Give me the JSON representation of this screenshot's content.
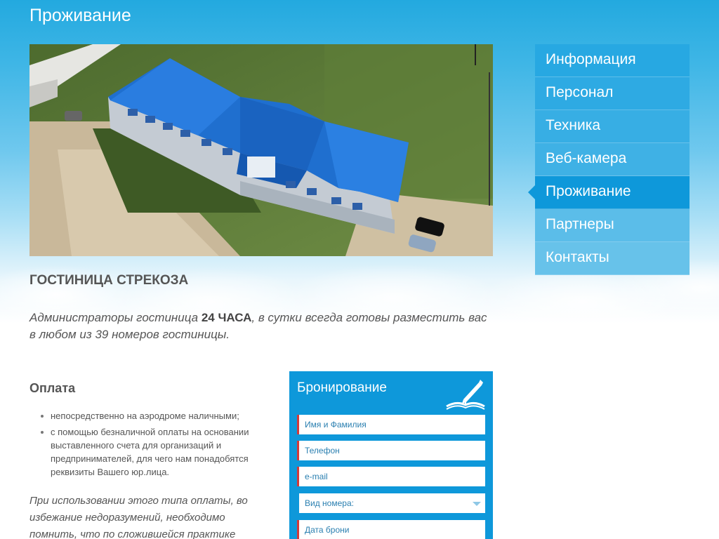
{
  "page": {
    "title": "Проживание"
  },
  "nav": {
    "items": [
      {
        "label": "Информация",
        "active": false,
        "bg": "#27a8e2"
      },
      {
        "label": "Персонал",
        "active": false,
        "bg": "#2eaae3"
      },
      {
        "label": "Техника",
        "active": false,
        "bg": "#37aee4"
      },
      {
        "label": "Веб-камера",
        "active": false,
        "bg": "#3fb1e5"
      },
      {
        "label": "Проживание",
        "active": true,
        "bg": "#0e98da"
      },
      {
        "label": "Партнеры",
        "active": false,
        "bg": "#5bbde9"
      },
      {
        "label": "Контакты",
        "active": false,
        "bg": "#67c2ea"
      }
    ]
  },
  "hotel": {
    "title_prefix": "ГОСТИНИЦА ",
    "title_bold": "СТРЕКОЗА",
    "intro_1": "Администраторы гостиница ",
    "intro_bold": "24 ЧАСА",
    "intro_2": ", в сутки всегда готовы разместить вас в любом из 39 номеров гостиницы."
  },
  "payment": {
    "title": "Оплата",
    "items": [
      "непосредственно на аэродроме наличными;",
      "с помощью безналичной оплаты на основании выставленного счета для организаций и предпринимателей, для чего нам понадобятся реквизиты Вашего юр.лица."
    ],
    "note": "При использовании этого типа оплаты, во избежание недоразумений, необходимо помнить, что по сложившейся практике работы банков"
  },
  "booking": {
    "title": "Бронирование",
    "fields": {
      "name": "Имя и Фамилия",
      "phone": "Телефон",
      "email": "e-mail",
      "room_type": "Вид номера:",
      "date": "Дата брони"
    }
  },
  "colors": {
    "accent": "#0e98da",
    "required_marker": "#d33a3a"
  }
}
